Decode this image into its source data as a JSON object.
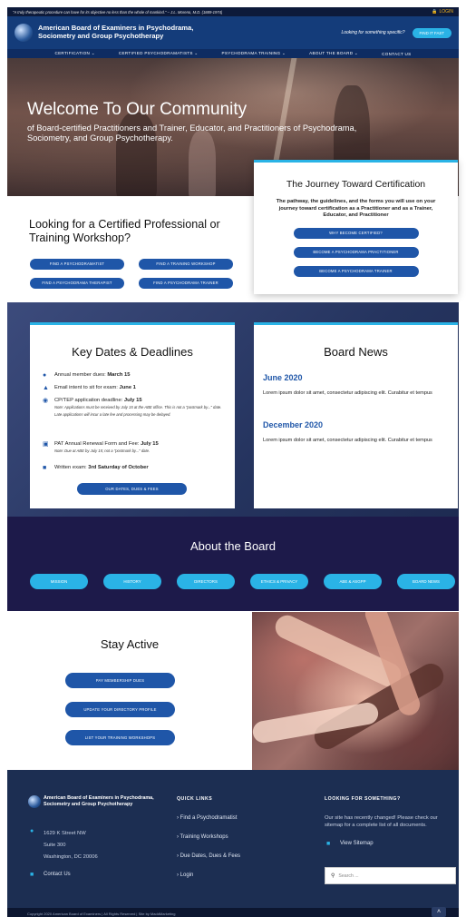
{
  "topbar": {
    "quote": "\"A truly therapeutic procedure can have for its objective no less than the whole of mankind.\" – J.L. Moreno, M.D. (1889-1974)",
    "login": "LOGIN"
  },
  "header": {
    "site_title": "American Board of Examiners in Psychodrama, Sociometry and Group Psychotherapy",
    "cta_question": "Looking for something specific?",
    "cta_button": "FIND IT FAST"
  },
  "nav": {
    "items": [
      "CERTIFICATION ⌄",
      "CERTIFIED PSYCHODRAMATISTS ⌄",
      "PSYCHODRAMA TRAINING ⌄",
      "ABOUT THE BOARD ⌄",
      "CONTACT US"
    ]
  },
  "hero": {
    "title": "Welcome To Our Community",
    "subtitle": "of Board-certified Practitioners and Trainer, Educator, and Practitioners of Psychodrama, Sociometry, and Group Psychotherapy."
  },
  "journey": {
    "title": "The Journey Toward Certification",
    "text": "The pathway, the guidelines, and the forms you will use on your journey toward certification as a Practitioner and as a Trainer, Educator, and Practitioner",
    "buttons": [
      "WHY BECOME CERTIFIED?",
      "BECOME A PSYCHODRAMA PRACTITIONER",
      "BECOME A PSYCHODRAMA TRAINER"
    ]
  },
  "looking": {
    "title": "Looking for a Certified Professional or Training Workshop?",
    "buttons": [
      "FIND A PSYCHODRAMATIST",
      "FIND A TRAINING WORKSHOP",
      "FIND A PSYCHODRAMA THERAPIST",
      "FIND A PSYCHODRAMA TRAINER"
    ]
  },
  "key_dates": {
    "title": "Key Dates & Deadlines",
    "items": [
      {
        "label": "Annual member dues: ",
        "value": "March 15"
      },
      {
        "label": "Email intent to sit for exam: ",
        "value": "June 1"
      },
      {
        "label": "CP/TEP application deadline: ",
        "value": "July 15"
      },
      {
        "label": "PAT Annual Renewal Form and Fee: ",
        "value": "July 15"
      },
      {
        "label": "Written exam: ",
        "value": "3rd Saturday of October"
      }
    ],
    "note_1": "Note: Applications must be received by July 15 at the ABE office. This is not a \"postmark by...\" date. Late applications will incur a late fee and processing may be delayed.",
    "note_2": "Note: Due at ABE by July 15; not a \"postmark by...\" date.",
    "button": "OUR DATES, DUES & FEES"
  },
  "news": {
    "title": "Board News",
    "entries": [
      {
        "heading": "June 2020",
        "body": "Lorem ipsum dolor sit amet, consectetur adipiscing elit. Curabitur et tempus"
      },
      {
        "heading": "December 2020",
        "body": "Lorem ipsum dolor sit amet, consectetur adipiscing elit. Curabitur et tempus"
      }
    ]
  },
  "about": {
    "title": "About the Board",
    "buttons": [
      "MISSION",
      "HISTORY",
      "DIRECTORS",
      "ETHICS & PRIVACY",
      "ABE & ASGPP",
      "BOARD NEWS"
    ]
  },
  "stay": {
    "title": "Stay Active",
    "buttons": [
      "PAY MEMBERSHIP DUES",
      "UPDATE YOUR DIRECTORY PROFILE",
      "LIST YOUR TRAINING WORKSHOPS"
    ]
  },
  "footer": {
    "org": "American Board of Examiners in Psychodrama, Sociometry and Group Psychotherapy",
    "address": [
      "1629 K Street NW",
      "Suite 300",
      "Washington, DC 20006"
    ],
    "contact": "Contact Us",
    "quick_links_title": "QUICK LINKS",
    "quick_links": [
      "› Find a Psychodramatist",
      "› Training Workshops",
      "› Due Dates, Dues & Fees",
      "› Login"
    ],
    "looking_title": "LOOKING FOR SOMETHING?",
    "looking_text": "Our site has recently changed! Please check our sitemap for a complete list of all documents.",
    "sitemap": "View Sitemap",
    "search_placeholder": "Search ...",
    "copyright": "Copyright 2020 American Board of Examiners | All Rights Reserved | Site by MaddMarketing"
  },
  "colors": {
    "navy": "#143c7a",
    "accent_blue": "#1f56a8",
    "cyan": "#2ab3e6",
    "about_bg": "#1d1a4a",
    "footer_bg": "#1c2e52"
  },
  "icons": [
    "lock-icon",
    "user-icon",
    "bank-icon",
    "clock-icon",
    "form-icon",
    "document-icon",
    "map-pin-icon",
    "book-icon",
    "sitemap-icon",
    "search-icon",
    "chevron-up-icon"
  ]
}
